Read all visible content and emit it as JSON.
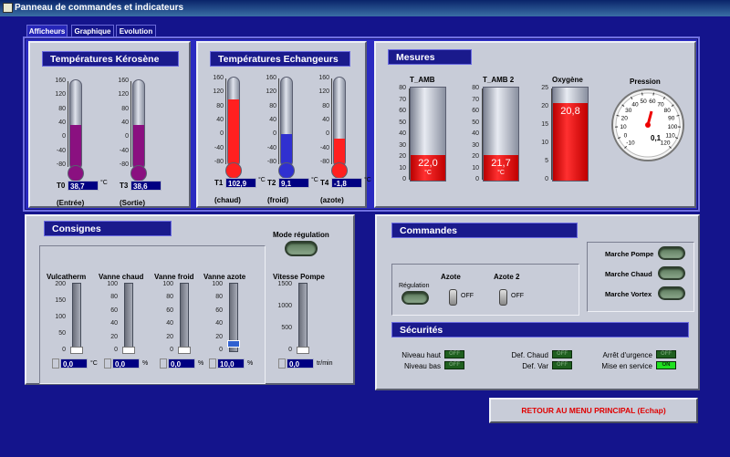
{
  "window": {
    "title": "Panneau de commandes et indicateurs"
  },
  "tabs": [
    "Afficheurs",
    "Graphique",
    "Evolution"
  ],
  "kerosene": {
    "title": "Températures Kérosène",
    "ticks": [
      "160",
      "120",
      "80",
      "40",
      "0",
      "-40",
      "-80"
    ],
    "therms": [
      {
        "id": "T0",
        "value": "38,7",
        "unit": "°C",
        "caption": "(Entrée)",
        "fill_pct": 50,
        "color": "#8a1080"
      },
      {
        "id": "T3",
        "value": "38,6",
        "unit": "",
        "caption": "(Sortie)",
        "fill_pct": 50,
        "color": "#8a1080"
      }
    ]
  },
  "echangeurs": {
    "title": "Températures Echangeurs",
    "ticks": [
      "160",
      "120",
      "80",
      "40",
      "0",
      "-40",
      "-80"
    ],
    "therms": [
      {
        "id": "T1",
        "value": "102,9",
        "unit": "°C",
        "caption": "(chaud)",
        "fill_pct": 76,
        "color": "#ff2020"
      },
      {
        "id": "T2",
        "value": "9,1",
        "unit": "°C",
        "caption": "(froid)",
        "fill_pct": 37,
        "color": "#3030d0"
      },
      {
        "id": "T4",
        "value": "-1,8",
        "unit": "°C",
        "caption": "(azote)",
        "fill_pct": 32,
        "color": "#ff2020"
      }
    ]
  },
  "mesures": {
    "title": "Mesures",
    "cylinders": [
      {
        "name": "T_AMB",
        "value": "22,0",
        "unit": "°C",
        "fill_pct": 27,
        "ticks": [
          "80",
          "70",
          "60",
          "50",
          "40",
          "30",
          "20",
          "10",
          "0"
        ]
      },
      {
        "name": "T_AMB 2",
        "value": "21,7",
        "unit": "°C",
        "fill_pct": 27,
        "ticks": [
          "80",
          "70",
          "60",
          "50",
          "40",
          "30",
          "20",
          "10",
          "0"
        ]
      },
      {
        "name": "Oxygène",
        "value": "20,8",
        "unit": "",
        "fill_pct": 83,
        "ticks": [
          "25",
          "20",
          "15",
          "10",
          "5",
          "0"
        ]
      }
    ],
    "gauge": {
      "name": "Pression",
      "value": "0,1",
      "ticks": [
        "-10",
        "0",
        "10",
        "20",
        "30",
        "40",
        "50",
        "60",
        "70",
        "80",
        "90",
        "100",
        "110",
        "120"
      ]
    }
  },
  "consignes": {
    "title": "Consignes",
    "mode_label": "Mode régulation",
    "sliders": [
      {
        "name": "Vulcatherm",
        "value": "0,0",
        "unit": "°C",
        "ticks": [
          "200",
          "150",
          "100",
          "50",
          "0"
        ],
        "level": 0,
        "active": false
      },
      {
        "name": "Vanne chaud",
        "value": "0,0",
        "unit": "%",
        "ticks": [
          "100",
          "80",
          "60",
          "40",
          "20",
          "0"
        ],
        "level": 0,
        "active": false
      },
      {
        "name": "Vanne froid",
        "value": "0,0",
        "unit": "%",
        "ticks": [
          "100",
          "80",
          "60",
          "40",
          "20",
          "0"
        ],
        "level": 0,
        "active": false
      },
      {
        "name": "Vanne azote",
        "value": "10,0",
        "unit": "%",
        "ticks": [
          "100",
          "80",
          "60",
          "40",
          "20",
          "0"
        ],
        "level": 10,
        "active": true
      }
    ],
    "pompe": {
      "name": "Vitesse Pompe",
      "value": "0,0",
      "unit": "tr/min",
      "ticks": [
        "1500",
        "1000",
        "500",
        "0"
      ],
      "level": 0
    }
  },
  "commandes": {
    "title": "Commandes",
    "regulation_label": "Régulation",
    "azote_label": "Azote",
    "azote2_label": "Azote 2",
    "off_label": "OFF",
    "marche_pompe": "Marche Pompe",
    "marche_chaud": "Marche Chaud",
    "marche_vortex": "Marche Vortex"
  },
  "securites": {
    "title": "Sécurités",
    "items": [
      {
        "label": "Niveau haut",
        "state": "OFF",
        "on": false
      },
      {
        "label": "Niveau bas",
        "state": "OFF",
        "on": false
      },
      {
        "label": "Def. Chaud",
        "state": "OFF",
        "on": false
      },
      {
        "label": "Def. Var",
        "state": "OFF",
        "on": false
      },
      {
        "label": "Arrêt d'urgence",
        "state": "OFF",
        "on": false
      },
      {
        "label": "Mise en service",
        "state": "ON",
        "on": true
      }
    ]
  },
  "retour_button": "RETOUR AU MENU PRINCIPAL  (Echap)"
}
